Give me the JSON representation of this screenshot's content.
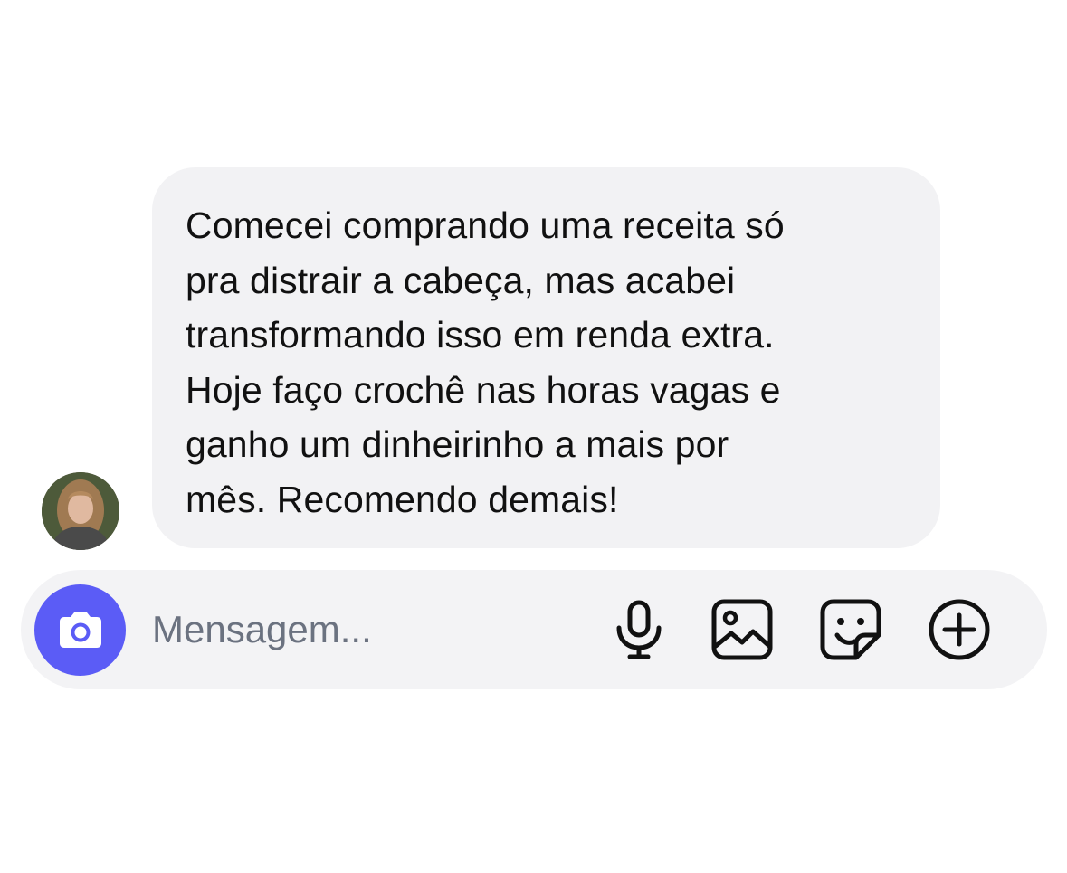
{
  "message": {
    "text": "Comecei comprando uma receita só\npra distrair a cabeça, mas acabei\ntransformando isso em renda extra.\nHoje faço crochê nas horas vagas e\nganho um dinheirinho a mais por\nmês. Recomendo demais!"
  },
  "composer": {
    "placeholder": "Mensagem..."
  },
  "icons": {
    "avatar": "user-avatar-photo",
    "camera": "camera-icon",
    "microphone": "microphone-icon",
    "gallery": "image-gallery-icon",
    "sticker": "sticker-icon",
    "add": "plus-circle-icon"
  },
  "colors": {
    "bubble_bg": "#f2f2f4",
    "composer_bg": "#f3f3f5",
    "camera_accent": "#5b5cf6",
    "placeholder_text": "#6b7280"
  }
}
